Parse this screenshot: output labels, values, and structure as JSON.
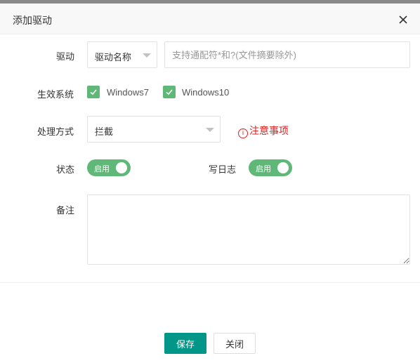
{
  "dialog": {
    "title": "添加驱动",
    "close_icon": "close-icon"
  },
  "form": {
    "driver": {
      "label": "驱动",
      "type_select": "驱动名称",
      "input_value": "",
      "input_placeholder": "支持通配符*和?(文件摘要除外)"
    },
    "systems": {
      "label": "生效系统",
      "options": [
        {
          "label": "Windows7",
          "checked": true
        },
        {
          "label": "Windows10",
          "checked": true
        }
      ]
    },
    "action": {
      "label": "处理方式",
      "selected": "拦截",
      "notice": "注意事项",
      "notice_icon": "ⓘ"
    },
    "status": {
      "label": "状态",
      "toggle_text": "启用",
      "on": true
    },
    "log": {
      "label": "写日志",
      "toggle_text": "启用",
      "on": true
    },
    "remark": {
      "label": "备注",
      "value": ""
    }
  },
  "footer": {
    "save_label": "保存",
    "close_label": "关闭"
  },
  "colors": {
    "accent_green": "#5fb878",
    "primary_button": "#009688",
    "warning_red": "#e02020"
  }
}
